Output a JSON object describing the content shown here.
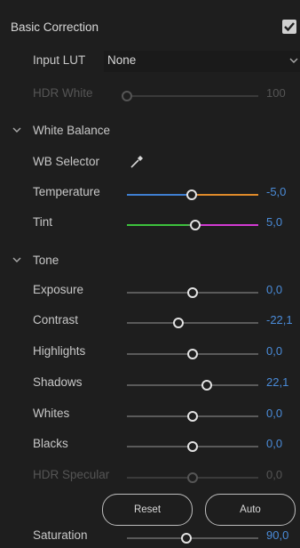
{
  "header": {
    "title": "Basic Correction",
    "enabled": true
  },
  "input_lut": {
    "label": "Input LUT",
    "value": "None"
  },
  "hdr_white": {
    "label": "HDR White",
    "value": "100",
    "position": 0.0
  },
  "white_balance": {
    "section_label": "White Balance",
    "wb_selector_label": "WB Selector",
    "temperature": {
      "label": "Temperature",
      "value": "-5,0",
      "position": 0.49
    },
    "tint": {
      "label": "Tint",
      "value": "5,0",
      "position": 0.52
    }
  },
  "tone": {
    "section_label": "Tone",
    "exposure": {
      "label": "Exposure",
      "value": "0,0",
      "position": 0.5
    },
    "contrast": {
      "label": "Contrast",
      "value": "-22,1",
      "position": 0.39
    },
    "highlights": {
      "label": "Highlights",
      "value": "0,0",
      "position": 0.5
    },
    "shadows": {
      "label": "Shadows",
      "value": "22,1",
      "position": 0.61
    },
    "whites": {
      "label": "Whites",
      "value": "0,0",
      "position": 0.5
    },
    "blacks": {
      "label": "Blacks",
      "value": "0,0",
      "position": 0.5
    },
    "hdr_specular": {
      "label": "HDR Specular",
      "value": "0,0",
      "position": 0.5
    }
  },
  "buttons": {
    "reset": "Reset",
    "auto": "Auto"
  },
  "saturation": {
    "label": "Saturation",
    "value": "90,0",
    "position": 0.45
  },
  "colors": {
    "accent_value": "#4a8bd8",
    "temp_blue": "#3f7fd1",
    "temp_orange": "#e08a2a",
    "tint_green": "#3cc23c",
    "tint_magenta": "#d23ad2"
  }
}
